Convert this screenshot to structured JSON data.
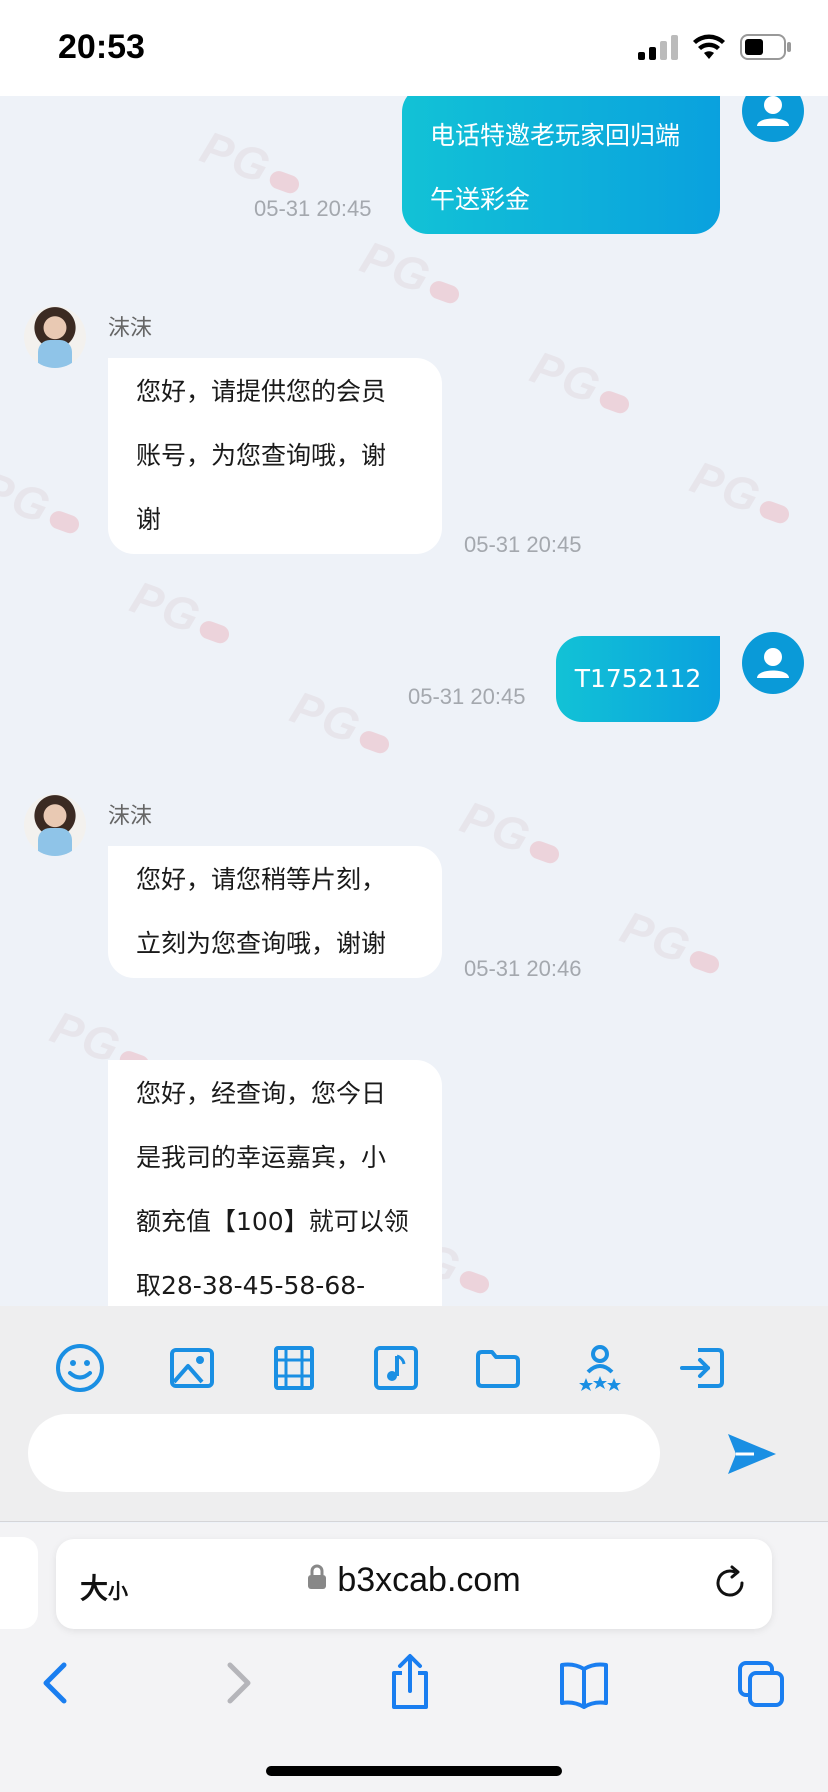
{
  "status_bar": {
    "time": "20:53"
  },
  "chat": {
    "messages": [
      {
        "sender": "user",
        "lines": [
          "电话特邀老玩家回归端",
          "午送彩金"
        ],
        "time": "05-31 20:45"
      },
      {
        "sender": "agent",
        "name": "沫沫",
        "lines": [
          "您好，请提供您的会员",
          "账号，为您查询哦，谢",
          "谢"
        ],
        "time": "05-31 20:45"
      },
      {
        "sender": "user",
        "lines": [
          "T1752112"
        ],
        "time": "05-31 20:45"
      },
      {
        "sender": "agent",
        "name": "沫沫",
        "lines": [
          "您好，请您稍等片刻，",
          "立刻为您查询哦，谢谢"
        ],
        "time": "05-31 20:46"
      },
      {
        "sender": "agent",
        "lines": [
          "您好，经查询，您今日",
          "是我司的幸运嘉宾，小",
          "额充值【100】就可以领",
          "取28-38-45-58-68-"
        ]
      }
    ],
    "watermark_text": "PG"
  },
  "toolbar": {
    "icons": [
      "emoji-icon",
      "image-icon",
      "video-icon",
      "music-icon",
      "folder-icon",
      "rating-icon",
      "exit-icon"
    ],
    "input_placeholder": "",
    "accent_color": "#1a8fe3"
  },
  "browser": {
    "text_size_label": "大",
    "text_size_small": "小",
    "url": "b3xcab.com"
  }
}
